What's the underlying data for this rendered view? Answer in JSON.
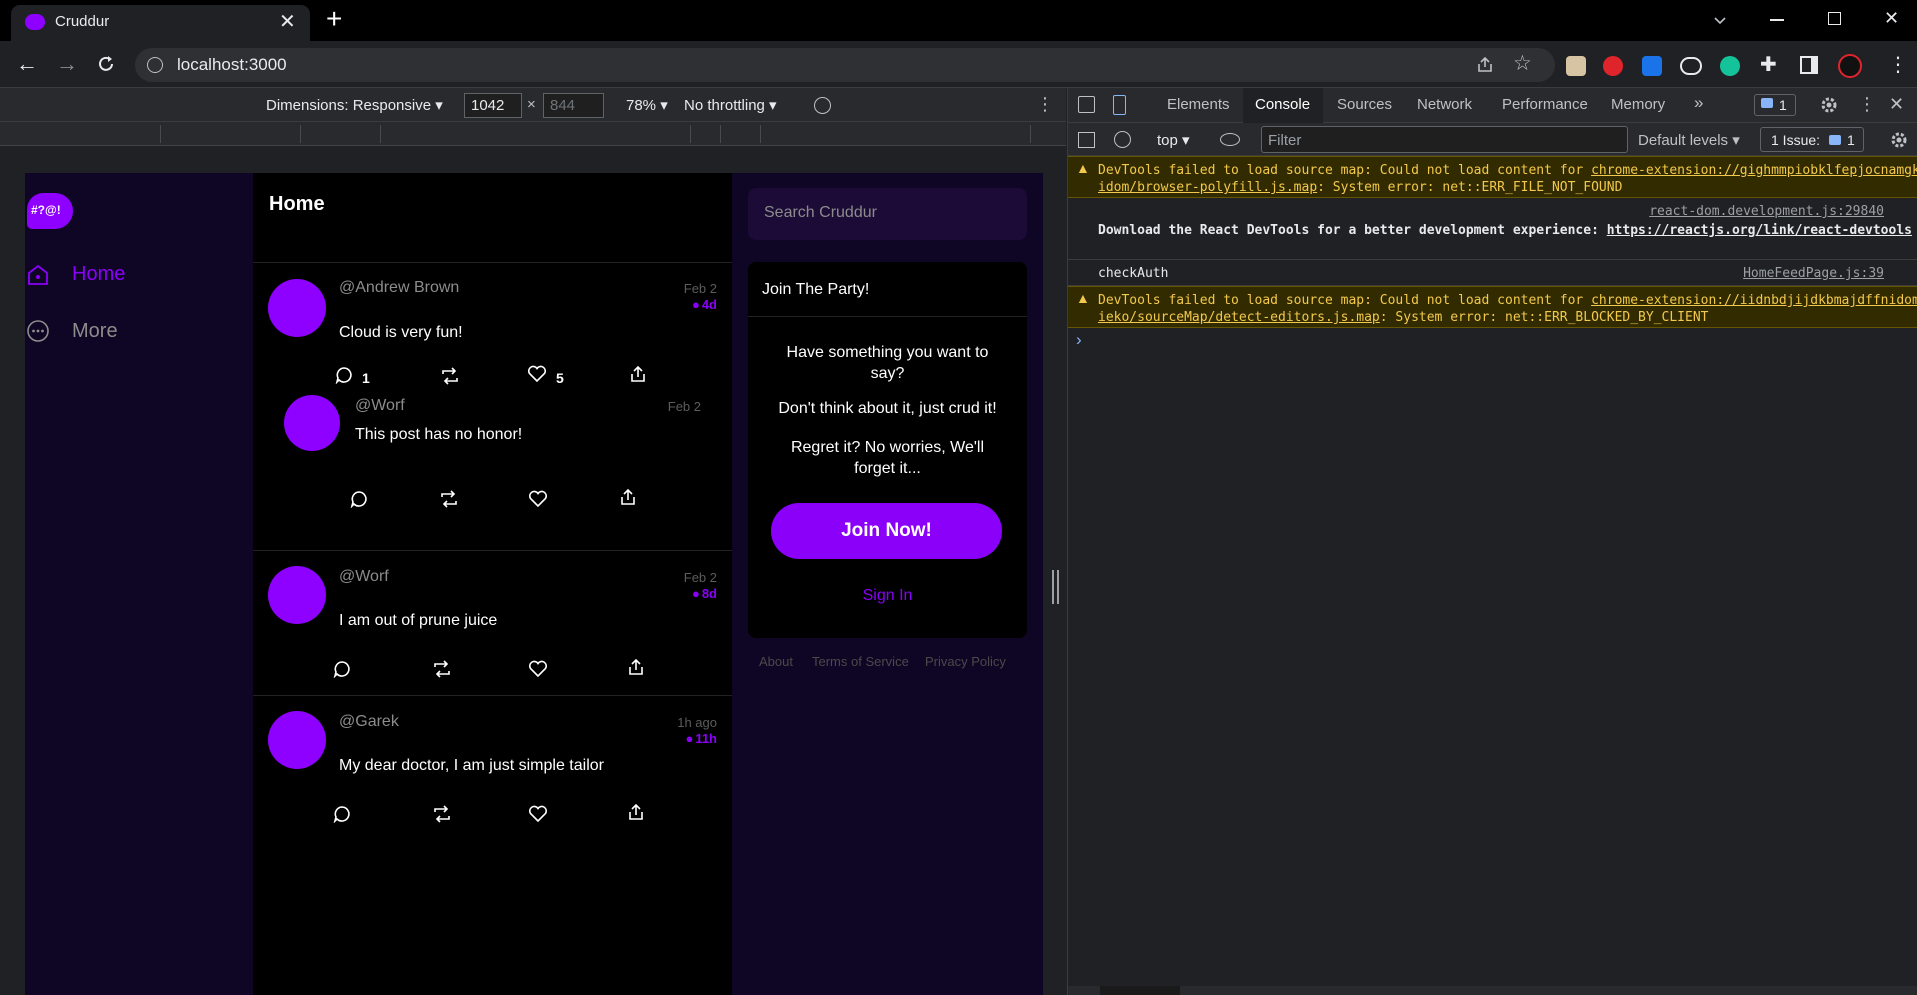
{
  "browser": {
    "tab_title": "Cruddur",
    "url": "localhost:3000"
  },
  "device_toolbar": {
    "dimensions": "Dimensions: Responsive",
    "width": "1042",
    "height_placeholder": "844",
    "times": "×",
    "zoom": "78%",
    "throttling": "No throttling"
  },
  "app": {
    "logo_text": "#?@!",
    "nav": [
      {
        "label": "Home"
      },
      {
        "label": "More"
      }
    ],
    "feed_title": "Home",
    "search_placeholder": "Search Cruddur",
    "posts": [
      {
        "handle": "@Andrew Brown",
        "text": "Cloud is very fun!",
        "date": "Feb 2",
        "ago": "4d",
        "replies": "1",
        "likes": "5"
      },
      {
        "handle": "@Worf",
        "text": "This post has no honor!",
        "date": "Feb 2"
      },
      {
        "handle": "@Worf",
        "text": "I am out of prune juice",
        "date": "Feb 2",
        "ago": "8d"
      },
      {
        "handle": "@Garek",
        "text": "My dear doctor, I am just simple tailor",
        "date": "1h ago",
        "ago": "11h"
      }
    ],
    "join": {
      "title": "Join The Party!",
      "p1": "Have something you want to say?",
      "p2": "Don't think about it, just crud it!",
      "p3": "Regret it? No worries, We'll forget it...",
      "button": "Join Now!",
      "signin": "Sign In"
    },
    "footer": [
      "About",
      "Terms of Service",
      "Privacy Policy"
    ]
  },
  "devtools": {
    "tabs": [
      "Elements",
      "Console",
      "Sources",
      "Network",
      "Performance",
      "Memory"
    ],
    "more_tabs": "»",
    "issues_badge": "1",
    "context": "top",
    "filter_placeholder": "Filter",
    "levels": "Default levels",
    "issue_label": "1 Issue:",
    "issue_count": "1",
    "console": [
      {
        "type": "warning",
        "prefix": "DevTools failed to load source map: Could not load content for ",
        "link": "chrome-extension://gighmmpiobklfepjocnamgkkbiglidom/browser-polyfill.js.map",
        "suffix": ": System error: net::ERR_FILE_NOT_FOUND"
      },
      {
        "type": "info",
        "source": "react-dom.development.js:29840",
        "prefix": "Download the React DevTools for a better development experience: ",
        "link": "https://reactjs.org/link/react-devtools"
      },
      {
        "type": "log",
        "text": "checkAuth",
        "source": "HomeFeedPage.js:39"
      },
      {
        "type": "warning",
        "prefix": "DevTools failed to load source map: Could not load content for ",
        "link": "chrome-extension://iidnbdjijdkbmajdffnidomddglmieko/sourceMap/detect-editors.js.map",
        "suffix": ": System error: net::ERR_BLOCKED_BY_CLIENT"
      }
    ],
    "prompt": "›"
  },
  "colors": {
    "brand": "#8e00ff",
    "sidebar_bg": "#0f0524",
    "warning_bg": "#332b00"
  }
}
